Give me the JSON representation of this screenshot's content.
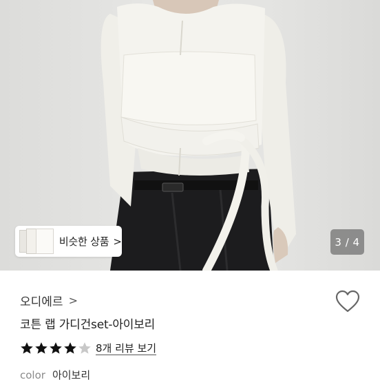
{
  "gallery": {
    "similar_button_label": "비슷한 상품",
    "similar_chevron": ">",
    "page_indicator": "3 / 4"
  },
  "product": {
    "brand": "오디에르",
    "brand_chevron": ">",
    "title": "코튼 랩 가디건set-아이보리",
    "rating": 4,
    "rating_max": 5,
    "review_link": "8개 리뷰 보기",
    "option_key": "color",
    "option_value": "아이보리"
  },
  "colors": {
    "background": "#ffffff",
    "star": "#111111",
    "star_empty": "#c8c8c8",
    "indicator_bg": "#6e6e6e"
  }
}
